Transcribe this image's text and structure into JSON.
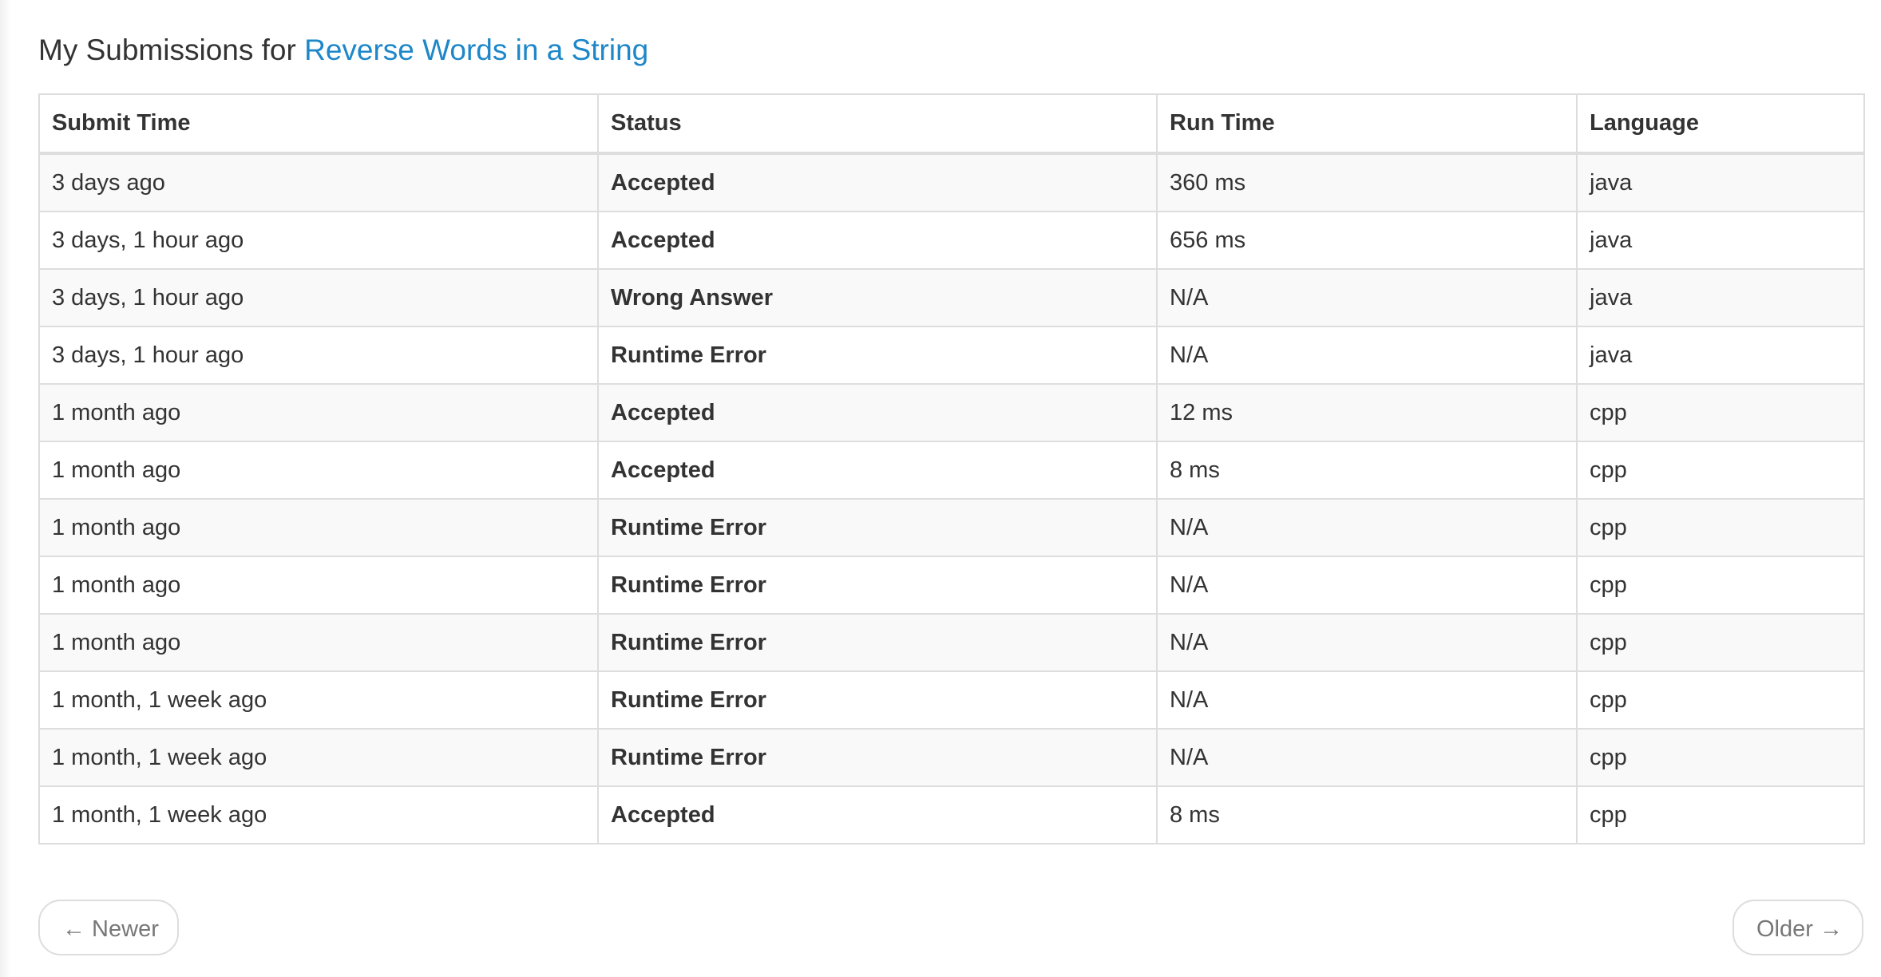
{
  "header": {
    "prefix": "My Submissions for",
    "problem_title": "Reverse Words in a String"
  },
  "table": {
    "columns": [
      "Submit Time",
      "Status",
      "Run Time",
      "Language"
    ],
    "rows": [
      {
        "submit_time": "3 days ago",
        "status": "Accepted",
        "run_time": "360 ms",
        "language": "java"
      },
      {
        "submit_time": "3 days, 1 hour ago",
        "status": "Accepted",
        "run_time": "656 ms",
        "language": "java"
      },
      {
        "submit_time": "3 days, 1 hour ago",
        "status": "Wrong Answer",
        "run_time": "N/A",
        "language": "java"
      },
      {
        "submit_time": "3 days, 1 hour ago",
        "status": "Runtime Error",
        "run_time": "N/A",
        "language": "java"
      },
      {
        "submit_time": "1 month ago",
        "status": "Accepted",
        "run_time": "12 ms",
        "language": "cpp"
      },
      {
        "submit_time": "1 month ago",
        "status": "Accepted",
        "run_time": "8 ms",
        "language": "cpp"
      },
      {
        "submit_time": "1 month ago",
        "status": "Runtime Error",
        "run_time": "N/A",
        "language": "cpp"
      },
      {
        "submit_time": "1 month ago",
        "status": "Runtime Error",
        "run_time": "N/A",
        "language": "cpp"
      },
      {
        "submit_time": "1 month ago",
        "status": "Runtime Error",
        "run_time": "N/A",
        "language": "cpp"
      },
      {
        "submit_time": "1 month, 1 week ago",
        "status": "Runtime Error",
        "run_time": "N/A",
        "language": "cpp"
      },
      {
        "submit_time": "1 month, 1 week ago",
        "status": "Runtime Error",
        "run_time": "N/A",
        "language": "cpp"
      },
      {
        "submit_time": "1 month, 1 week ago",
        "status": "Accepted",
        "run_time": "8 ms",
        "language": "cpp"
      }
    ]
  },
  "pager": {
    "newer_label": "← Newer",
    "older_label": "Older →"
  },
  "colors": {
    "link": "#1e87c9",
    "accepted": "#3c763d",
    "error": "#a94442",
    "border": "#dddddd",
    "stripe": "#f9f9f9"
  }
}
